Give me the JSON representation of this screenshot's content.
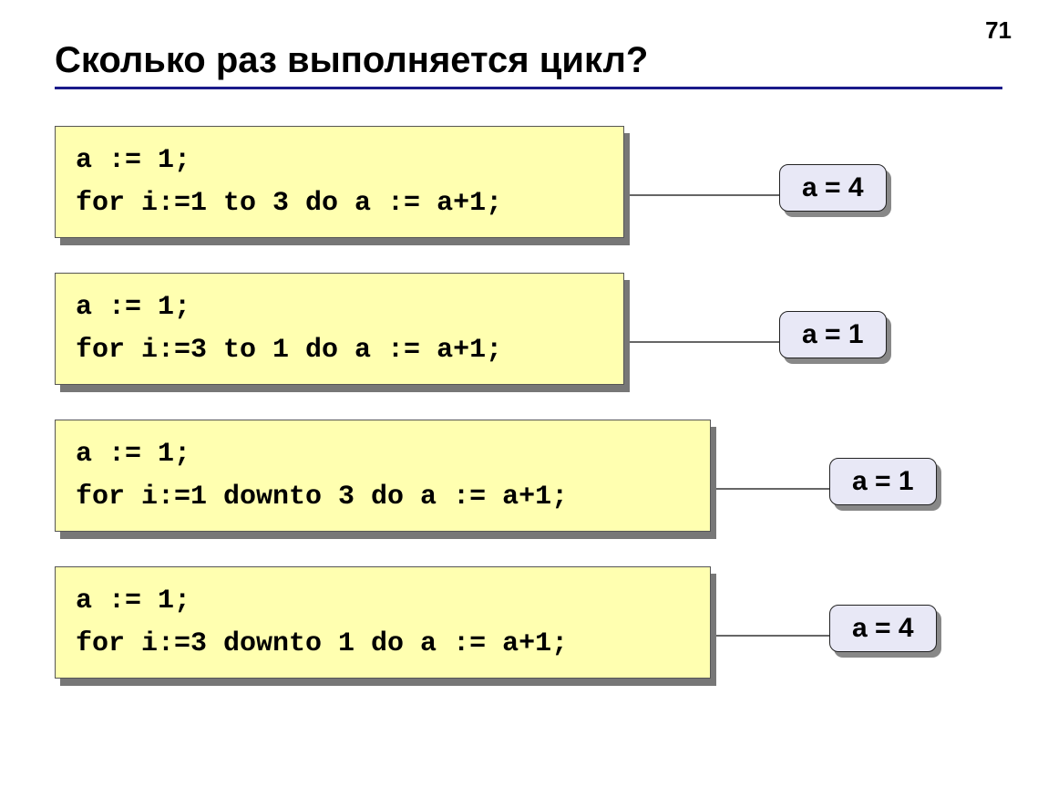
{
  "page_number": "71",
  "title": "Сколько раз выполняется цикл?",
  "blocks": [
    {
      "code": "a := 1;\nfor i:=1 to 3 do a := a+1;",
      "result": "a = 4",
      "code_width": 625,
      "connector_width": 170
    },
    {
      "code": "a := 1;\nfor i:=3 to 1 do a := a+1;",
      "result": "a = 1",
      "code_width": 625,
      "connector_width": 170
    },
    {
      "code": "a := 1;\nfor i:=1 downto 3 do a := a+1;",
      "result": "a = 1",
      "code_width": 720,
      "connector_width": 130
    },
    {
      "code": "a := 1;\nfor i:=3 downto 1 do a := a+1;",
      "result": "a = 4",
      "code_width": 720,
      "connector_width": 130
    }
  ]
}
